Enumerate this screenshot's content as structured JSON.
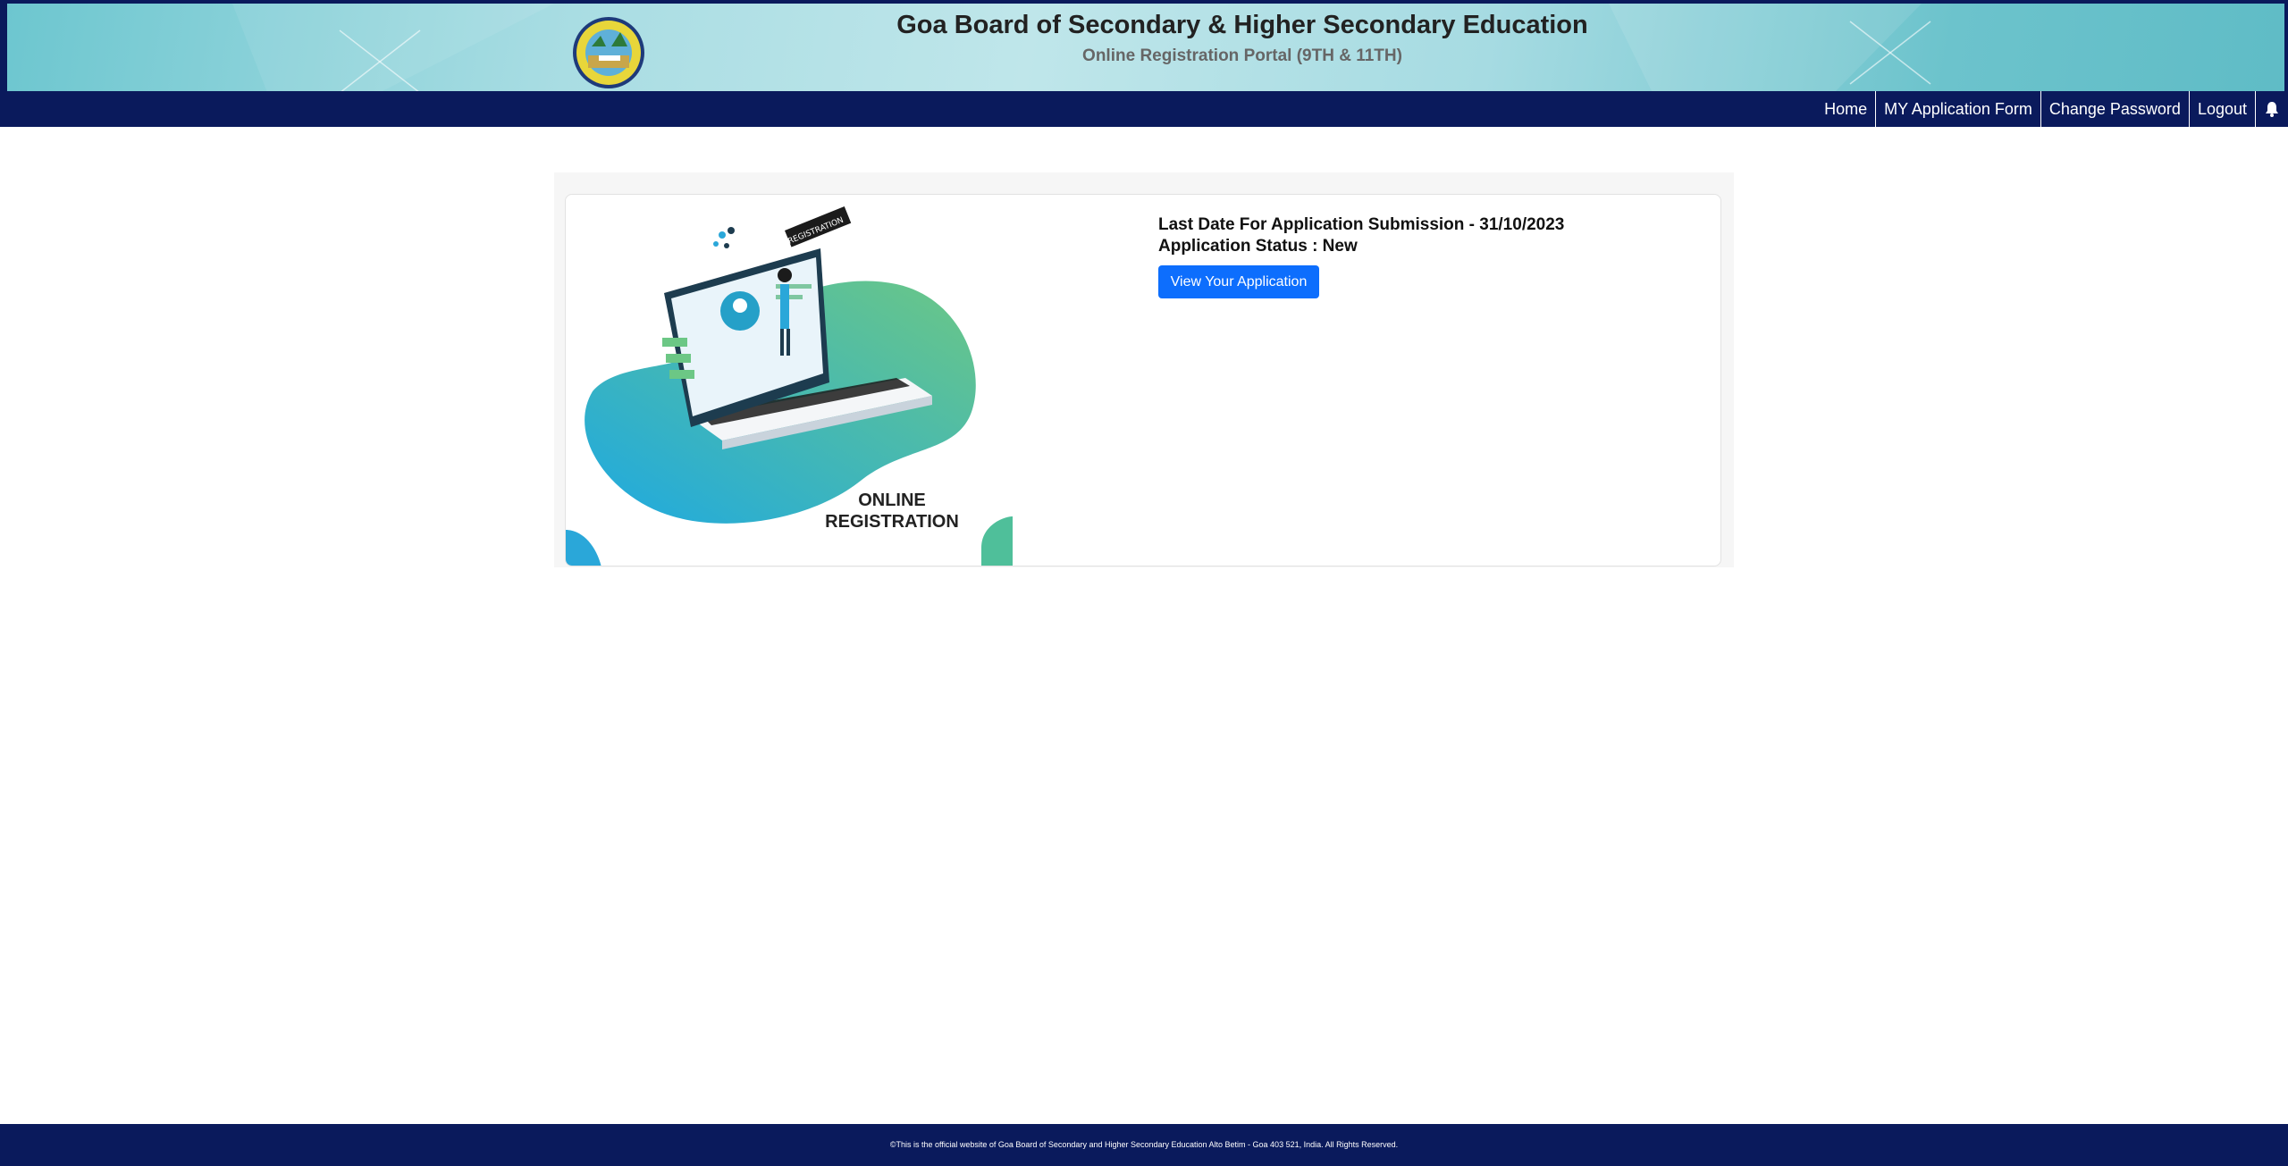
{
  "header": {
    "title": "Goa Board of Secondary & Higher Secondary Education",
    "subtitle": "Online Registration Portal (9TH & 11TH)"
  },
  "nav": {
    "items": [
      "Home",
      "MY Application Form",
      "Change Password",
      "Logout"
    ],
    "bell_icon": "bell-icon"
  },
  "illustration": {
    "line1": "ONLINE",
    "line2": "REGISTRATION",
    "tag": "REGISTRATION"
  },
  "application": {
    "last_date": "Last Date For Application Submission - 31/10/2023",
    "status": "Application Status : New",
    "view_button": "View Your Application"
  },
  "footer": {
    "text": "©This is the official website of Goa Board of Secondary and Higher Secondary Education Alto Betim - Goa 403 521, India. All Rights Reserved."
  },
  "colors": {
    "navbar": "#0a1a5c",
    "button": "#0d6efd"
  }
}
